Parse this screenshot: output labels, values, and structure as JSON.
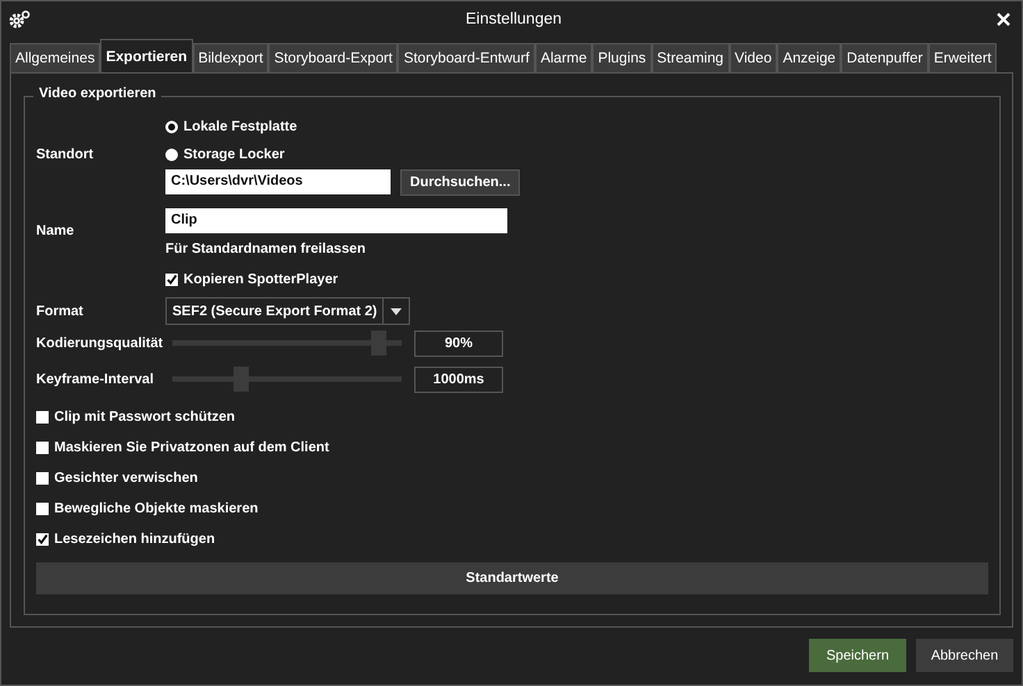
{
  "window": {
    "title": "Einstellungen"
  },
  "tabs": [
    {
      "label": "Allgemeines",
      "selected": false
    },
    {
      "label": "Exportieren",
      "selected": true
    },
    {
      "label": "Bildexport",
      "selected": false
    },
    {
      "label": "Storyboard-Export",
      "selected": false
    },
    {
      "label": "Storyboard-Entwurf",
      "selected": false
    },
    {
      "label": "Alarme",
      "selected": false
    },
    {
      "label": "Plugins",
      "selected": false
    },
    {
      "label": "Streaming",
      "selected": false
    },
    {
      "label": "Video",
      "selected": false
    },
    {
      "label": "Anzeige",
      "selected": false
    },
    {
      "label": "Datenpuffer",
      "selected": false
    },
    {
      "label": "Erweitert",
      "selected": false
    }
  ],
  "group": {
    "title": "Video exportieren",
    "location": {
      "label": "Standort",
      "options": [
        {
          "label": "Lokale Festplatte",
          "selected": true
        },
        {
          "label": "Storage Locker",
          "selected": false
        }
      ],
      "path": "C:\\Users\\dvr\\Videos",
      "browse_button": "Durchsuchen..."
    },
    "name": {
      "label": "Name",
      "value": "Clip",
      "hint": "Für Standardnamen freilassen",
      "copy_player": {
        "label": "Kopieren SpotterPlayer",
        "checked": true
      }
    },
    "format": {
      "label": "Format",
      "value": "SEF2 (Secure Export Format 2)"
    },
    "sliders": [
      {
        "label": "Kodierungsqualität",
        "level": 0.9,
        "reading": "90%"
      },
      {
        "label": "Keyframe-Interval",
        "level": 0.3,
        "reading": "1000ms"
      }
    ],
    "options": [
      {
        "label": "Clip mit Passwort schützen",
        "checked": false
      },
      {
        "label": "Maskieren Sie Privatzonen auf dem Client",
        "checked": false
      },
      {
        "label": "Gesichter verwischen",
        "checked": false
      },
      {
        "label": "Bewegliche Objekte maskieren",
        "checked": false
      },
      {
        "label": "Lesezeichen hinzufügen",
        "checked": true
      }
    ],
    "defaults_button": "Standartwerte"
  },
  "buttons": [
    {
      "label": "Speichern",
      "kind": "primary"
    },
    {
      "label": "Abbrechen",
      "kind": "secondary"
    }
  ]
}
